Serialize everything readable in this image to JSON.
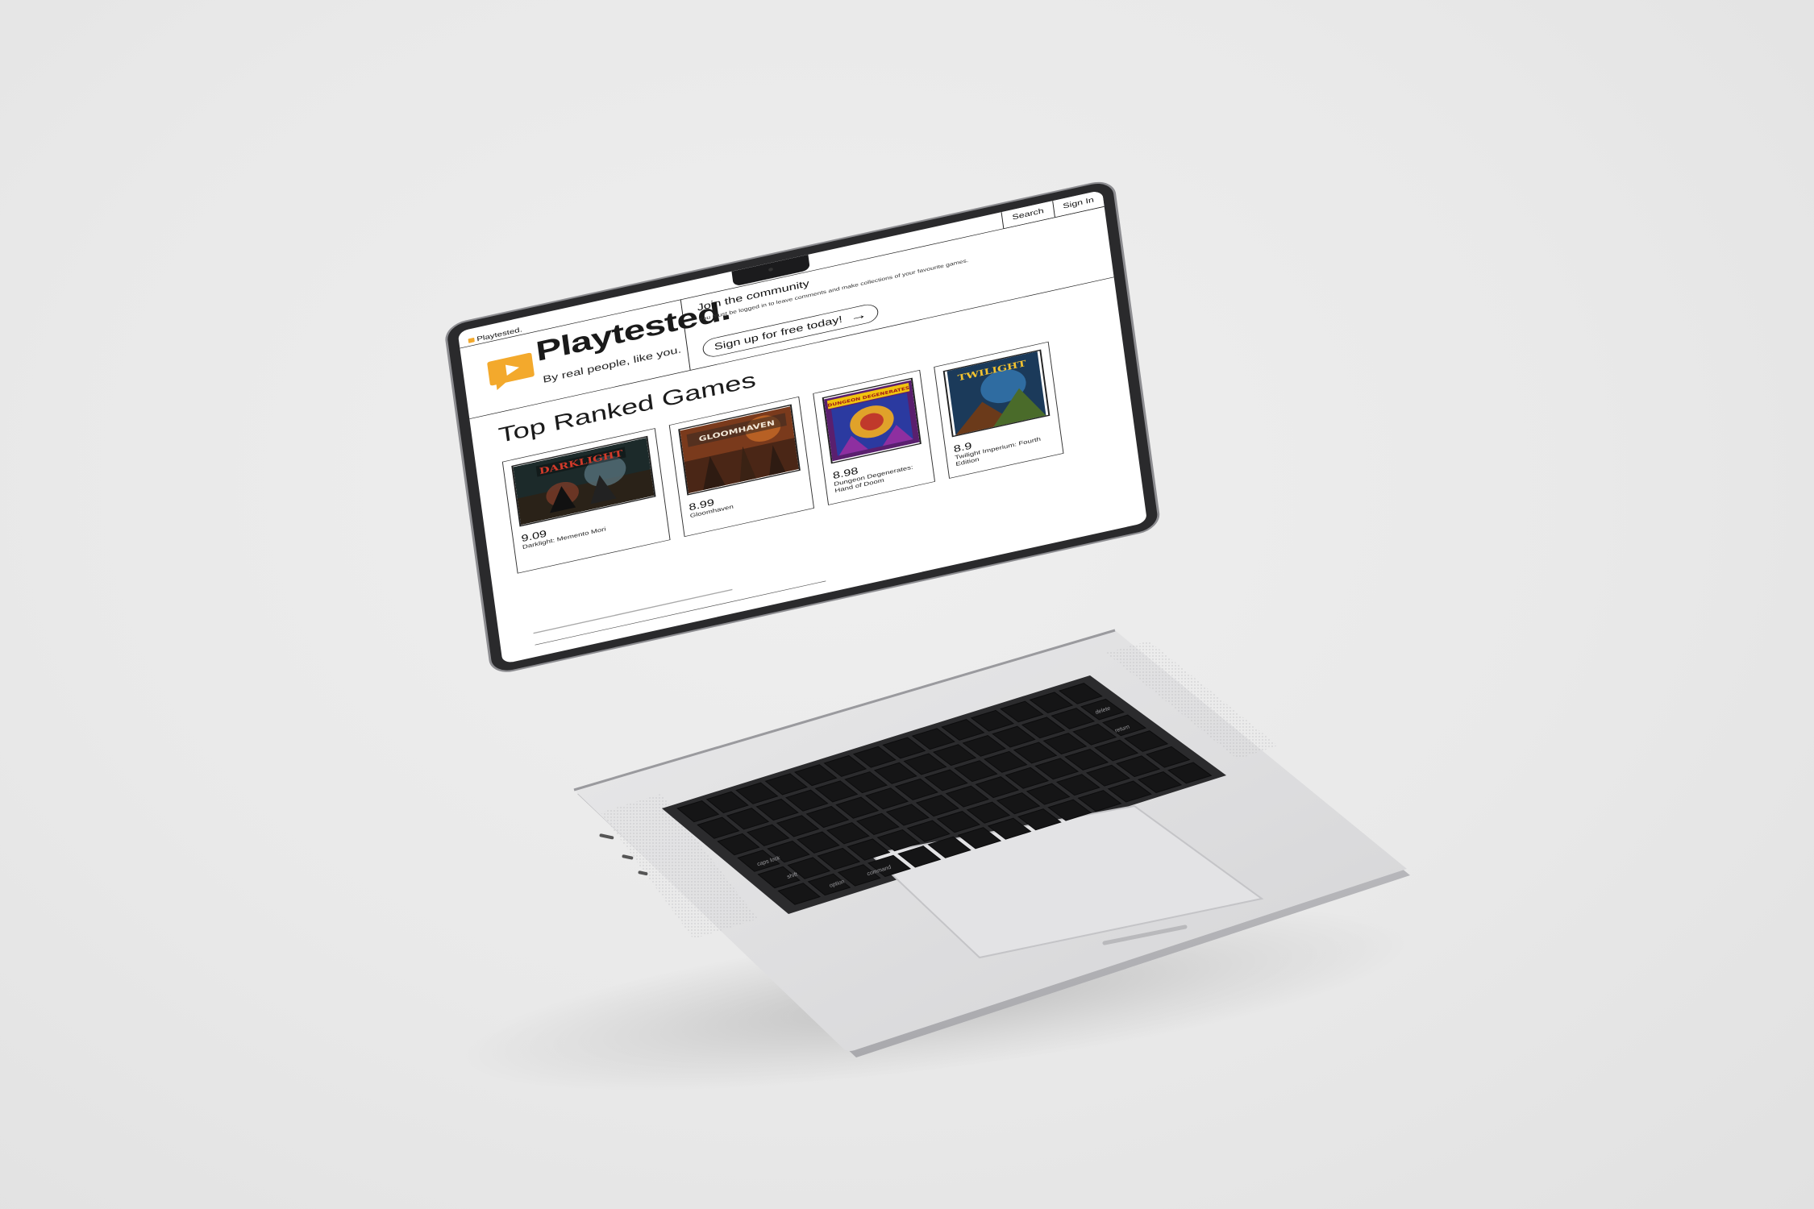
{
  "browser_nav": {
    "search_label": "Search",
    "signin_label": "Sign In"
  },
  "site": {
    "small_brand": "Playtested.",
    "title": "Playtested.",
    "tagline": "By real people, like you.",
    "brand_color": "#f3a92c"
  },
  "community": {
    "title": "Join the community",
    "note": "You must be logged in to leave comments and make collections of your favourite games.",
    "cta_label": "Sign up for free today!",
    "cta_icon": "arrow-right-icon"
  },
  "section_title": "Top Ranked Games",
  "games": [
    {
      "score": "9.09",
      "name": "Darklight: Memento Mori",
      "art_title": "DARKLIGHT"
    },
    {
      "score": "8.99",
      "name": "Gloomhaven",
      "art_title": "GLOOMHAVEN"
    },
    {
      "score": "8.98",
      "name": "Dungeon Degenerates: Hand of Doom",
      "art_title": "DUNGEON DEGENERATES"
    },
    {
      "score": "8.9",
      "name": "Twilight Imperium: Fourth Edition",
      "art_title": "TWILIGHT"
    }
  ],
  "keyboard_labels": {
    "delete": "delete",
    "return": "return",
    "caps_lock": "caps lock",
    "command": "command",
    "option": "option",
    "shift": "shift"
  }
}
